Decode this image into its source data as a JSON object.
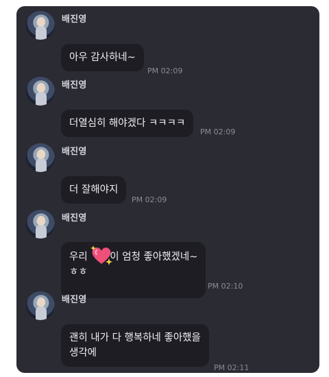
{
  "chat": {
    "messages": [
      {
        "sender": "배진영",
        "text": "아우 감사하네~",
        "time": "PM 02:09"
      },
      {
        "sender": "배진영",
        "text": "더열심히 해야겠다 ㅋㅋㅋㅋ",
        "time": "PM 02:09"
      },
      {
        "sender": "배진영",
        "text": "더 잘해야지",
        "time": "PM 02:09"
      },
      {
        "sender": "배진영",
        "line1_before": "우리 ",
        "line1_after": "이 엄청 좋아했겠네~",
        "line2": "ㅎㅎ",
        "emoji": "sparkling-heart-icon",
        "time": "PM 02:10"
      },
      {
        "sender": "배진영",
        "line1": "괜히 내가 다 행복하네 좋아했을",
        "line2": "생각에",
        "time": "PM 02:11"
      }
    ]
  },
  "colors": {
    "background": "#2b2b33",
    "bubble": "#1d1d23",
    "text": "#f0f0f3",
    "timestamp": "#8c8c96",
    "heart": "#f04f7a"
  }
}
